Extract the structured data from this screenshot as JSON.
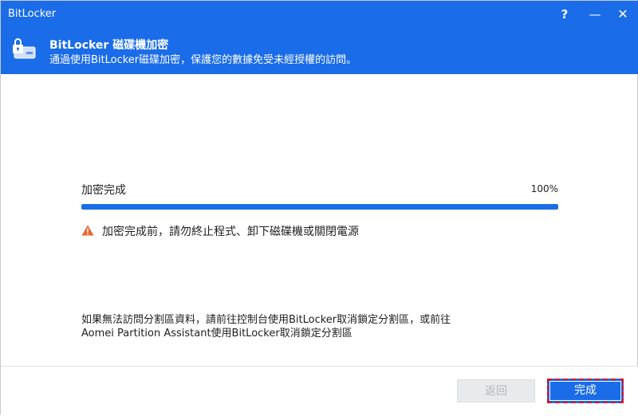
{
  "window": {
    "title": "BitLocker"
  },
  "titlebar": {
    "help": "?",
    "minimize": "—",
    "close": "✕"
  },
  "header": {
    "title": "BitLocker 磁碟機加密",
    "subtitle": "通過使用BitLocker磁碟加密，保護您的數據免受未經授權的訪問。",
    "icon": "lock-drive-icon"
  },
  "progress": {
    "label": "加密完成",
    "percent_text": "100%",
    "value": 100
  },
  "warning": {
    "icon": "warning-icon",
    "text": "加密完成前，請勿終止程式、卸下磁碟機或關閉電源"
  },
  "info": {
    "line1": "如果無法訪問分割區資料，請前往控制台使用BitLocker取消鎖定分割區，或前往",
    "line2": "Aomei Partition Assistant使用BitLocker取消鎖定分割區"
  },
  "footer": {
    "back_label": "返回",
    "finish_label": "完成"
  },
  "colors": {
    "accent": "#1a6ce8",
    "warning": "#e8662e",
    "highlight_border": "#e0102a"
  }
}
